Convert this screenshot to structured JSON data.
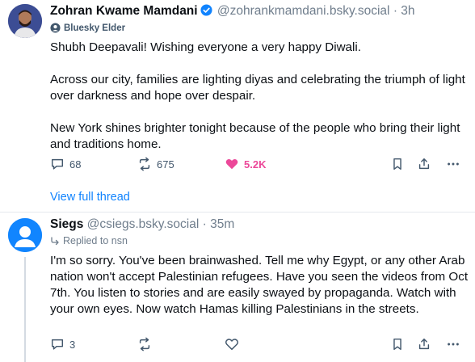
{
  "post1": {
    "author_name": "Zohran Kwame Mamdani",
    "handle": "@zohrankmamdani.bsky.social",
    "separator": "·",
    "time": "3h",
    "badge_label": "Bluesky Elder",
    "paragraphs": [
      "Shubh Deepavali! Wishing everyone a very happy Diwali.",
      "Across our city, families are lighting diyas and celebrating the triumph of light over darkness and hope over despair.",
      "New York shines brighter tonight because of the people who bring their light and traditions home."
    ],
    "replies": "68",
    "reposts": "675",
    "likes": "5.2K",
    "liked": true
  },
  "view_full_thread": "View full thread",
  "post2": {
    "author_name": "Siegs",
    "handle": "@csiegs.bsky.social",
    "separator": "·",
    "time": "35m",
    "replied_to": "Replied to nsn",
    "body": "I'm so sorry. You've been brainwashed. Tell me why Egypt, or any other Arab nation won't accept Palestinian refugees. Have you seen the videos from Oct 7th. You listen to stories and are easily swayed by propaganda. Watch with your own eyes. Now watch Hamas killing Palestinians in the streets.",
    "replies": "3"
  },
  "colors": {
    "accent_blue": "#1083fe",
    "like_pink": "#ec4899",
    "muted_text": "#6f7d8c",
    "icon_gray": "#42576c"
  }
}
